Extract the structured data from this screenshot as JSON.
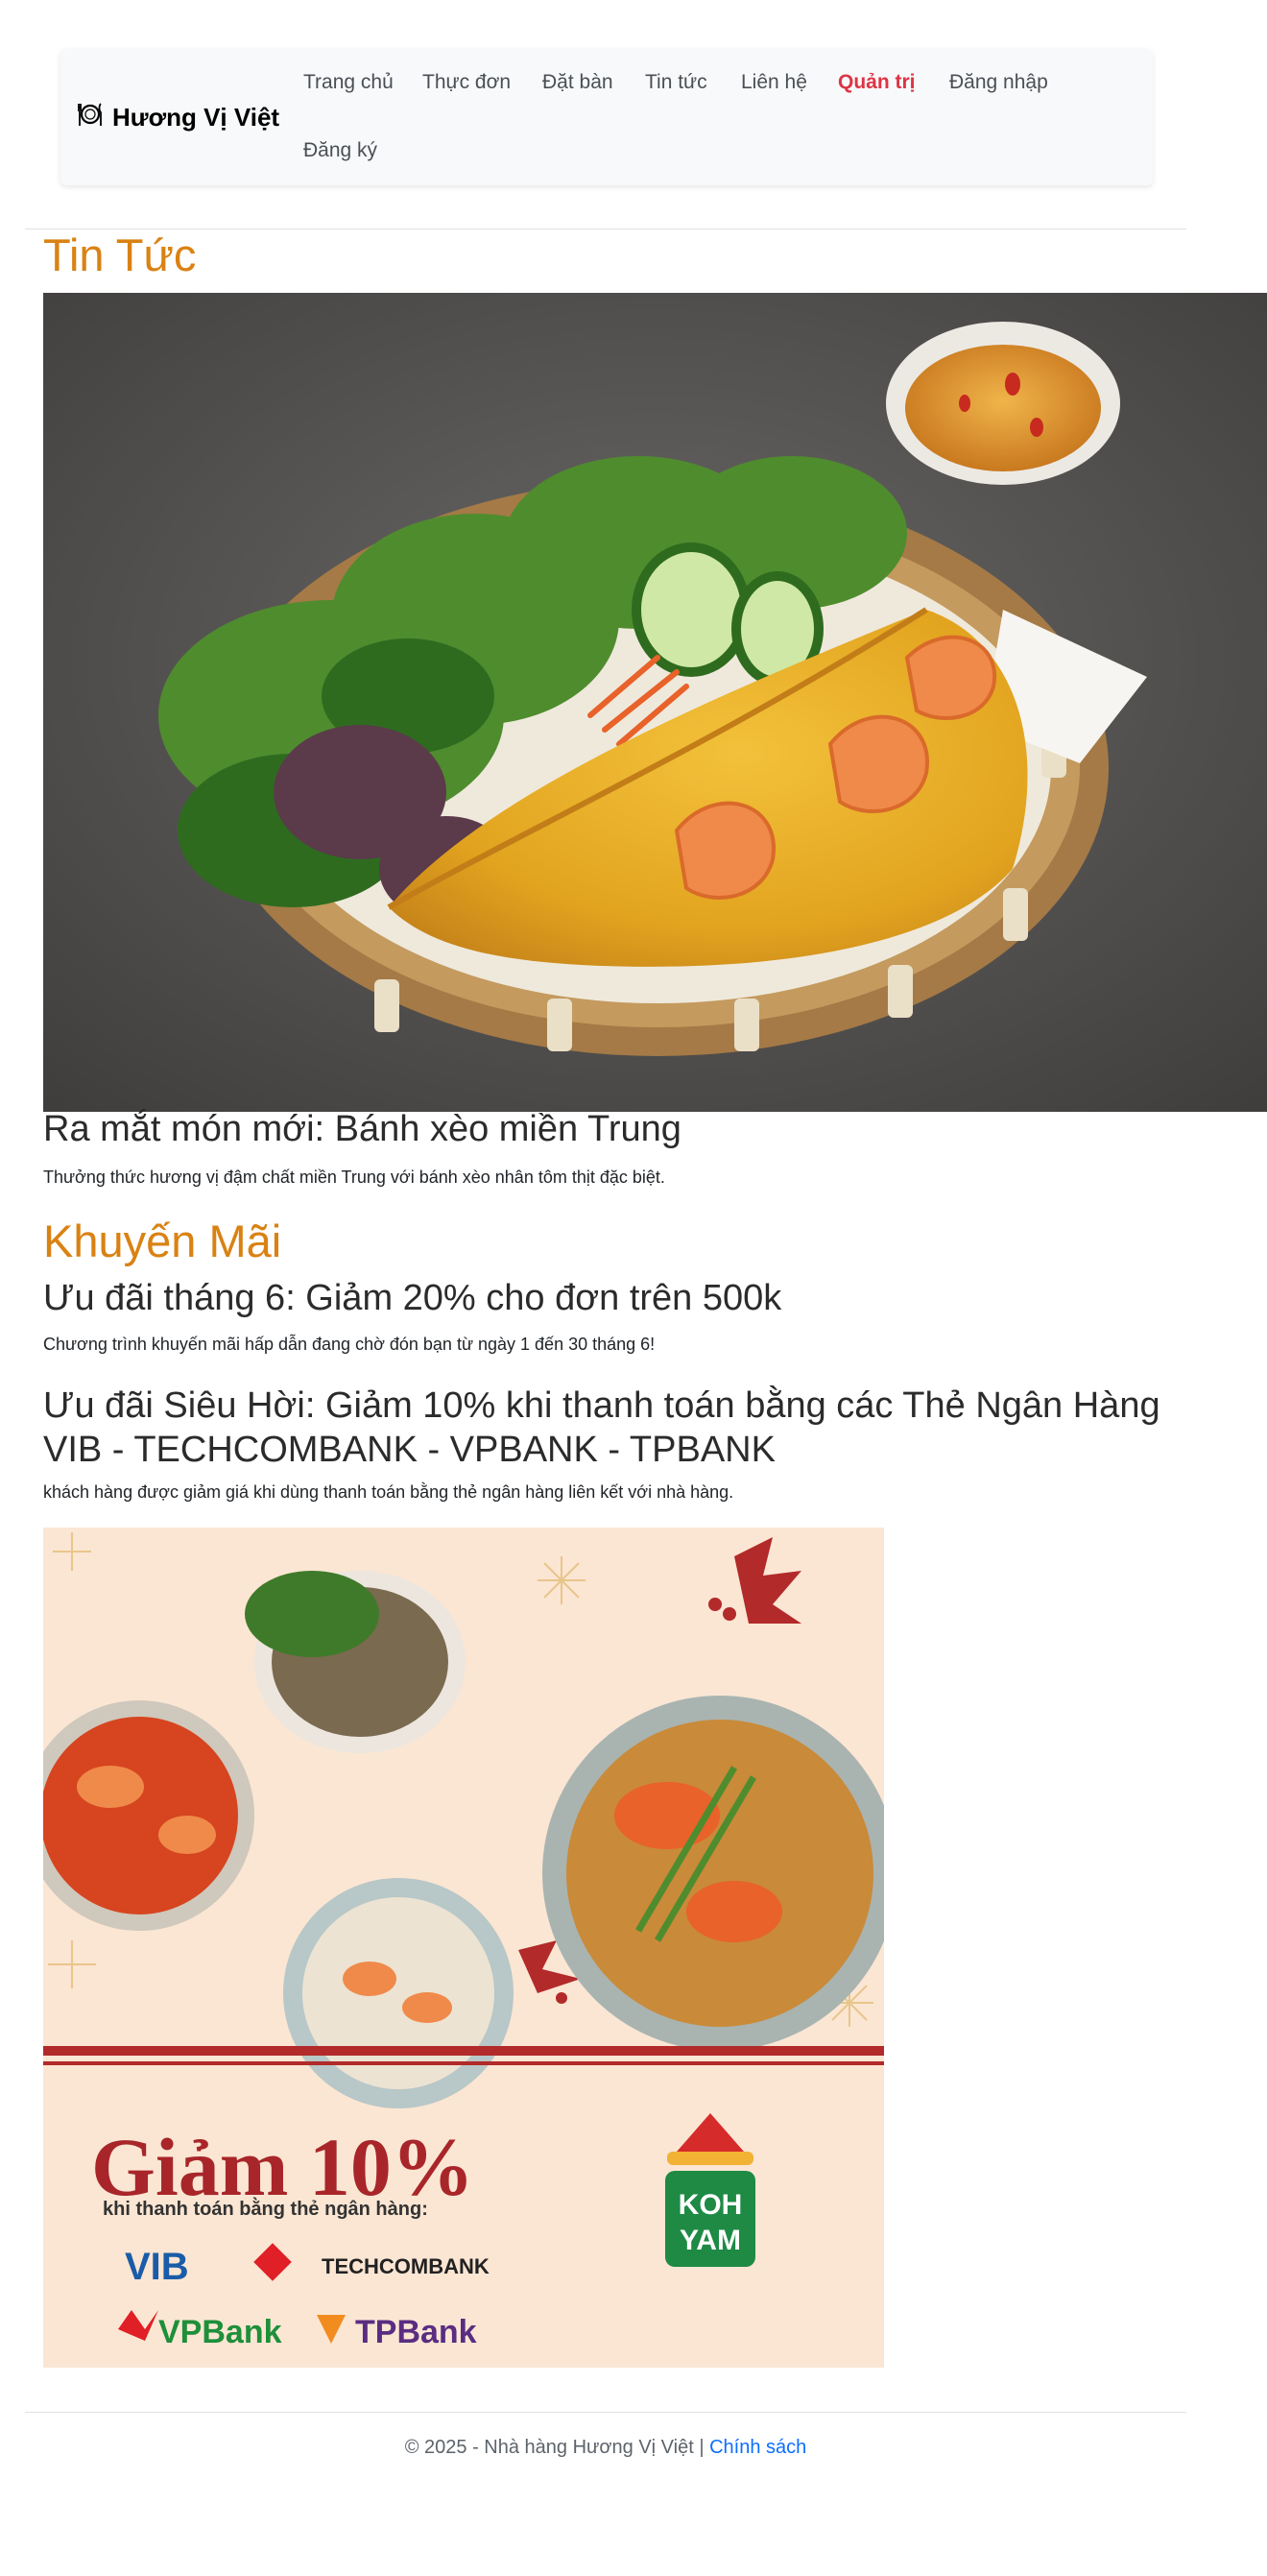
{
  "brand": {
    "name": "Hương Vị Việt",
    "icon": "plate-utensils-icon"
  },
  "nav": {
    "items": [
      {
        "label": "Trang chủ"
      },
      {
        "label": "Thực đơn"
      },
      {
        "label": "Đặt bàn"
      },
      {
        "label": "Tin tức"
      },
      {
        "label": "Liên hệ"
      },
      {
        "label": "Quản trị"
      },
      {
        "label": "Đăng nhập"
      },
      {
        "label": "Đăng ký"
      }
    ]
  },
  "news": {
    "heading": "Tin Tức",
    "items": [
      {
        "title": "Ra mắt món mới: Bánh xèo miền Trung",
        "text": "Thưởng thức hương vị đậm chất miền Trung với bánh xèo nhân tôm thịt đặc biệt."
      }
    ]
  },
  "promotions": {
    "heading": "Khuyến Mãi",
    "items": [
      {
        "title": "Ưu đãi tháng 6: Giảm 20% cho đơn trên 500k",
        "text": "Chương trình khuyến mãi hấp dẫn đang chờ đón bạn từ ngày 1 đến 30 tháng 6!"
      },
      {
        "title": "Ưu đãi Siêu Hời: Giảm 10% khi thanh toán bằng các Thẻ Ngân Hàng VIB - TECHCOMBANK - VPBANK - TPBANK",
        "text": "khách hàng được giảm giá khi dùng thanh toán bằng thẻ ngân hàng liên kết với nhà hàng."
      }
    ],
    "banner": {
      "headline": "Giảm 10%",
      "subline": "khi thanh toán bằng thẻ ngân hàng:",
      "banks": [
        "VIB",
        "TECHCOMBANK",
        "VPBank",
        "TPBank"
      ],
      "logo_lines": [
        "KOH",
        "YAM"
      ]
    }
  },
  "footer": {
    "text": "© 2025 - Nhà hàng Hương Vị Việt |",
    "policy_link": "Chính sách"
  },
  "colors": {
    "accent": "#d98213",
    "admin": "#dc3545",
    "link": "#0d6efd",
    "banner_red": "#b22a2a"
  }
}
